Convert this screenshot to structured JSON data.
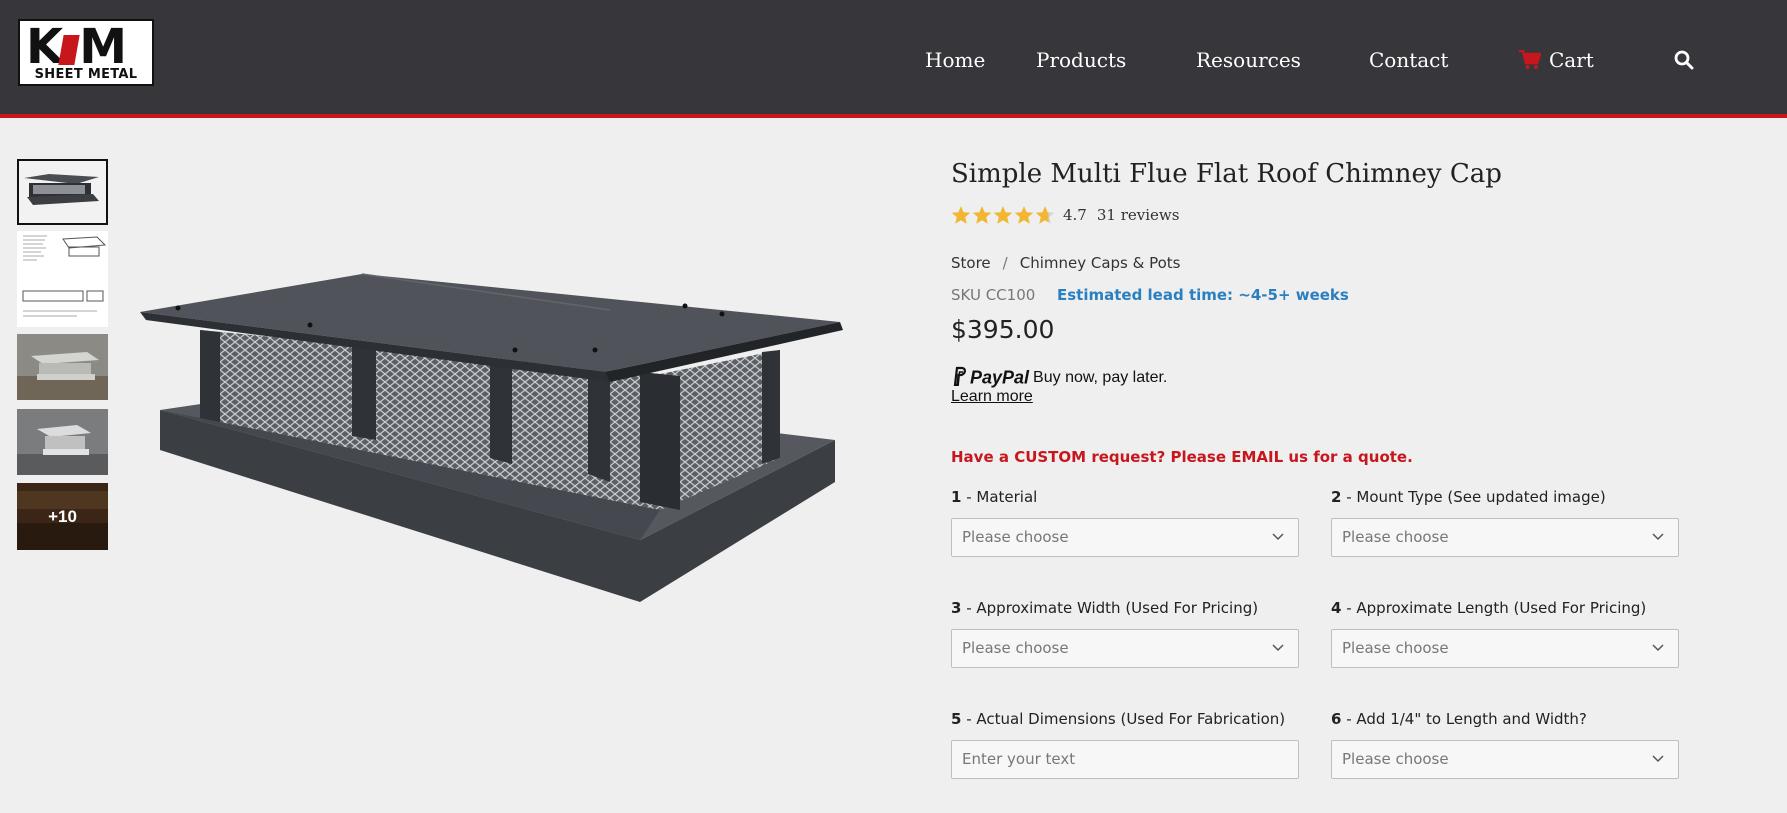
{
  "brand": {
    "logo_text": "K&M",
    "logo_subtext": "SHEET METAL"
  },
  "nav": {
    "items": [
      {
        "label": "Home"
      },
      {
        "label": "Products"
      },
      {
        "label": "Resources"
      },
      {
        "label": "Contact"
      }
    ],
    "cart_label": "Cart",
    "cart_icon": "cart-icon",
    "search_icon": "search-icon"
  },
  "gallery": {
    "more_label": "+10"
  },
  "product": {
    "title": "Simple Multi Flue Flat Roof Chimney Cap",
    "rating": {
      "value": "4.7",
      "reviews_label": "31 reviews",
      "stars": 4.7
    },
    "breadcrumb": [
      "Store",
      "Chimney Caps & Pots"
    ],
    "breadcrumb_separator": "/",
    "sku": "SKU CC100",
    "lead_time": "Estimated lead time: ~4-5+ weeks",
    "price": "$395.00",
    "paypal": {
      "logo": "PayPal",
      "text": "Buy now, pay later.",
      "link": "Learn more"
    },
    "custom_request": "Have a CUSTOM request? Please EMAIL us for a quote."
  },
  "options": [
    {
      "number": "1",
      "label": "Material",
      "value": "Please choose"
    },
    {
      "number": "2",
      "label": "Mount Type (See updated image)",
      "value": "Please choose"
    },
    {
      "number": "3",
      "label": "Approximate Width (Used For Pricing)",
      "value": "Please choose"
    },
    {
      "number": "4",
      "label": "Approximate Length (Used For Pricing)",
      "value": "Please choose"
    },
    {
      "number": "5",
      "label": "Actual Dimensions (Used For Fabrication)",
      "placeholder": "Enter your text"
    },
    {
      "number": "6",
      "label": "Add 1/4\" to Length and Width?",
      "value": "Please choose"
    }
  ],
  "colors": {
    "header_bg": "#36363b",
    "accent_red": "#c8161d",
    "lead_blue": "#2a7fc1",
    "star_gold": "#f2b632"
  }
}
